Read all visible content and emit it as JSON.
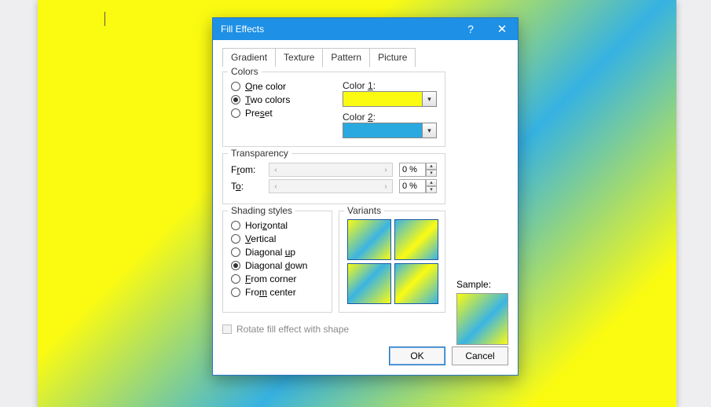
{
  "dialog": {
    "title": "Fill Effects",
    "help_glyph": "?",
    "close_glyph": "✕"
  },
  "tabs": [
    "Gradient",
    "Texture",
    "Pattern",
    "Picture"
  ],
  "active_tab_index": 0,
  "colors_group": {
    "legend": "Colors",
    "options": [
      {
        "key": "one",
        "label": "One color",
        "access": "O"
      },
      {
        "key": "two",
        "label": "Two colors",
        "access": "T"
      },
      {
        "key": "pre",
        "label": "Preset",
        "access": "s"
      }
    ],
    "selected": "two",
    "color1_label": "Color 1:",
    "color1_access": "1",
    "color1_hex": "#fbfb12",
    "color2_label": "Color 2:",
    "color2_access": "2",
    "color2_hex": "#2aa9e0"
  },
  "transparency_group": {
    "legend": "Transparency",
    "from_label": "From:",
    "from_access": "r",
    "from_value": "0 %",
    "to_label": "To:",
    "to_access": "o",
    "to_value": "0 %"
  },
  "shading_group": {
    "legend": "Shading styles",
    "options": [
      {
        "key": "horiz",
        "label": "Horizontal",
        "access": "z"
      },
      {
        "key": "vert",
        "label": "Vertical",
        "access": "V"
      },
      {
        "key": "diagu",
        "label": "Diagonal up",
        "access": "u"
      },
      {
        "key": "diagd",
        "label": "Diagonal down",
        "access": "d"
      },
      {
        "key": "corner",
        "label": "From corner",
        "access": "F"
      },
      {
        "key": "center",
        "label": "From center",
        "access": "m"
      }
    ],
    "selected": "diagd"
  },
  "variants_group": {
    "legend": "Variants"
  },
  "sample_label": "Sample:",
  "rotate_checkbox": {
    "label": "Rotate fill effect with shape",
    "checked": false,
    "enabled": false
  },
  "buttons": {
    "ok": "OK",
    "cancel": "Cancel"
  }
}
